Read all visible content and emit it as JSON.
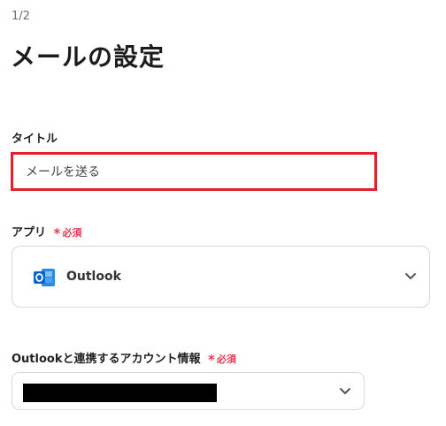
{
  "header": {
    "step": "1/2",
    "title": "メールの設定"
  },
  "title_field": {
    "label": "タイトル",
    "value": "メールを送る",
    "highlight_color": "#e5202d"
  },
  "app_field": {
    "label": "アプリ",
    "required_text": "必須",
    "selected_app": "Outlook",
    "app_icon": "outlook-icon",
    "dropdown_icon": "chevron-down-icon"
  },
  "account_field": {
    "label": "Outlookと連携するアカウント情報",
    "required_text": "必須",
    "value_redacted": true,
    "dropdown_icon": "chevron-down-icon"
  },
  "colors": {
    "required": "#e33b53",
    "outlook_blue": "#0a64c8",
    "border": "#d8d8d8"
  }
}
